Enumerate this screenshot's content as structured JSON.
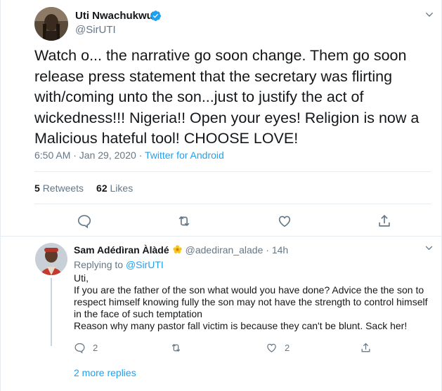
{
  "tweet": {
    "author_name": "Uti Nwachukwu",
    "author_handle": "@SirUTI",
    "text": "Watch o... the narrative go soon change. Them go soon release press statement that the secretary was flirting with/coming unto the son...just to justify the act of wickedness!!! Nigeria!! Open your eyes! Religion is now a Malicious hateful tool! CHOOSE LOVE!",
    "timestamp": "6:50 AM · Jan 29, 2020",
    "separator": " · ",
    "source": "Twitter for Android",
    "retweets_count": "5",
    "retweets_label": "Retweets",
    "likes_count": "62",
    "likes_label": "Likes"
  },
  "reply": {
    "author_name": "Sam Adédìran Àlàdé",
    "author_handle": "@adediran_alade",
    "time_ago": "14h",
    "separator": " · ",
    "replying_prefix": "Replying to ",
    "replying_to": "@SirUTI",
    "lines": [
      "Uti,",
      "If you are the father of the son what would you have done? Advice the the son to respect himself knowing fully the son may not have the strength to control himself in the face of such temptation",
      "Reason why many pastor fall victim is because they can't be blunt. Sack her!"
    ],
    "reply_count": "2",
    "like_count": "2"
  },
  "more_replies": "2 more replies",
  "colors": {
    "accent": "#1da1f2",
    "secondary_text": "#657786",
    "divider": "#e6ecf0"
  },
  "icons": [
    "verified-icon",
    "chevron-down-icon",
    "reply-icon",
    "retweet-icon",
    "like-icon",
    "share-icon",
    "flower-icon"
  ]
}
